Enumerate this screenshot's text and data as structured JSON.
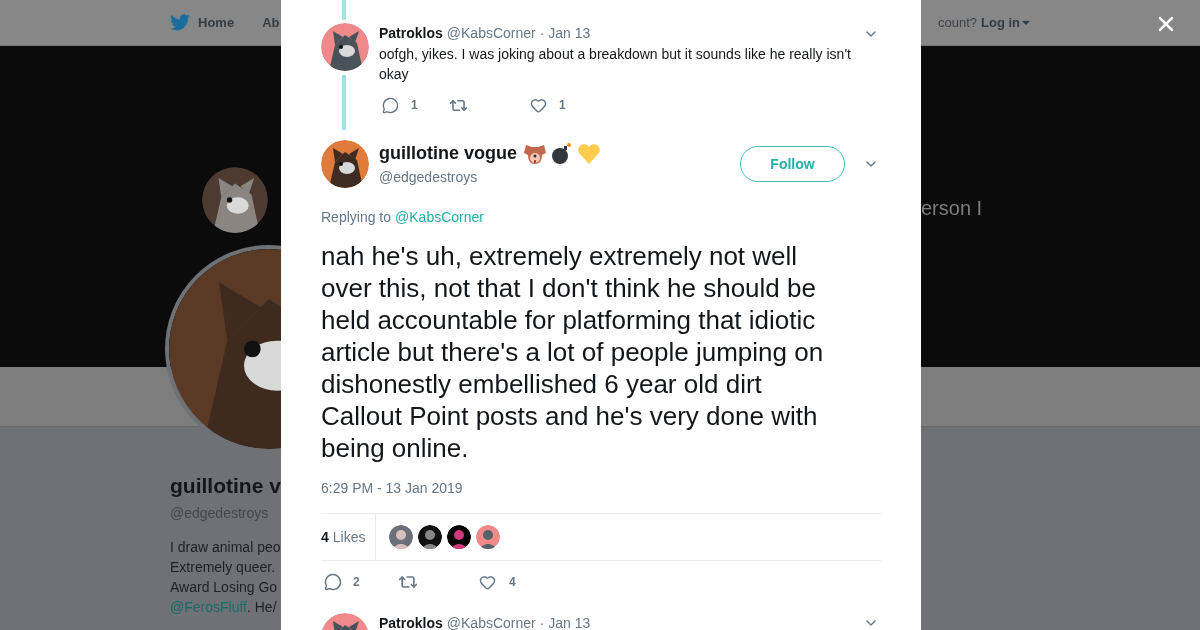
{
  "background_page": {
    "nav": {
      "items": [
        {
          "label": "Home"
        },
        {
          "label": "Ab"
        }
      ],
      "account_prompt": "count?",
      "login": "Log in"
    },
    "banner_text": "erson I",
    "profile": {
      "name": "guillotine v",
      "handle": "@edgedestroys",
      "bio_lines": [
        "I draw animal peo",
        "Extremely queer.",
        "Award Losing Go"
      ],
      "bio_link": "@FerosFluff",
      "bio_after": ". He/"
    }
  },
  "modal": {
    "parent_reply": {
      "name": "Patroklos",
      "handle": "@KabsCorner",
      "date": "· Jan 13",
      "text": "oofgh, yikes. I was joking about a breakdown but it sounds like he really isn't okay",
      "reply_count": "1",
      "like_count": "1"
    },
    "tweet": {
      "name": "guillotine vogue",
      "handle": "@edgedestroys",
      "follow": "Follow",
      "replying_label": "Replying to",
      "replying_to": "@KabsCorner",
      "text": "nah he's uh, extremely extremely not well over this, not that I don't think he should be held accountable for platforming that idiotic article but there's a lot of people jumping on dishonestly embellished 6 year old dirt Callout Point posts and he's very done with being online.",
      "timestamp": "6:29 PM - 13 Jan 2019",
      "likes_count": "4",
      "likes_label": "Likes",
      "reply_count": "2",
      "like_count": "4"
    },
    "next_reply": {
      "name": "Patroklos",
      "handle": "@KabsCorner",
      "date": "· Jan 13"
    }
  }
}
